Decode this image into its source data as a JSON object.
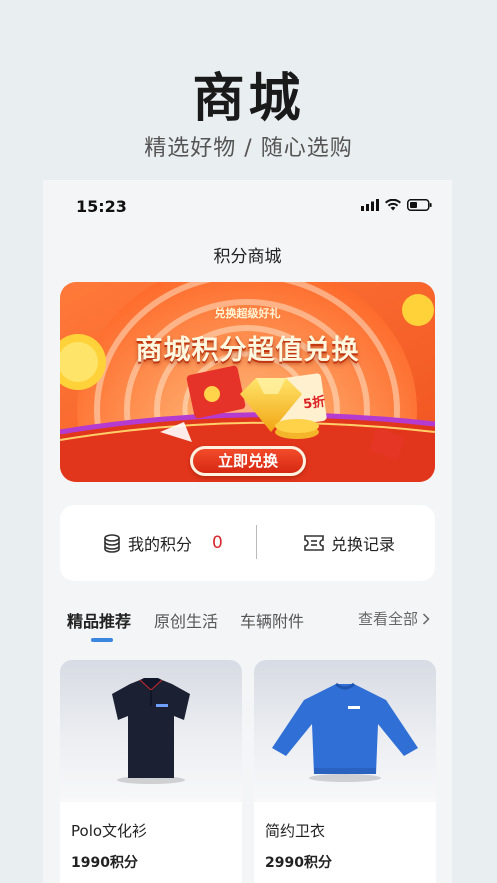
{
  "promo": {
    "title": "商城",
    "subtitle": "精选好物 / 随心选购"
  },
  "status_bar": {
    "time": "15:23"
  },
  "nav": {
    "title": "积分商城"
  },
  "banner": {
    "subtitle": "兑换超级好礼",
    "headline": "商城积分超值兑换",
    "discount": "5折",
    "button_label": "立即兑换"
  },
  "points": {
    "label": "我的积分",
    "value": "0",
    "records_label": "兑换记录"
  },
  "tabs": {
    "items": [
      {
        "label": "精品推荐"
      },
      {
        "label": "原创生活"
      },
      {
        "label": "车辆附件"
      }
    ],
    "view_all": "查看全部"
  },
  "products": [
    {
      "name": "Polo文化衫",
      "price": "1990积分",
      "color": "#1b2033"
    },
    {
      "name": "简约卫衣",
      "price": "2990积分",
      "color": "#2f6fd6"
    }
  ],
  "colors": {
    "accent": "#3a87e0",
    "points_value": "#d9272e",
    "banner_orange": "#f26a2a"
  }
}
